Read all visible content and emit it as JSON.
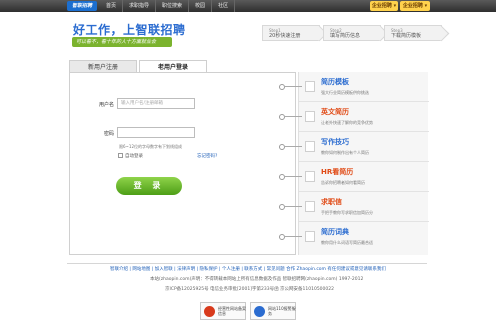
{
  "topbar": {
    "logo": "智联招聘",
    "nav": [
      "首页",
      "求职指导",
      "职位搜索",
      "校园",
      "社区"
    ],
    "enterprise_buttons": [
      "企业招聘 ▾",
      "企业招聘 ▾"
    ]
  },
  "header": {
    "slogan": "好工作，上智联招聘",
    "subslogan": "可以看不，看十年的人十方面就业会",
    "steps": [
      {
        "num": "Step1",
        "label": "20秒快速注册"
      },
      {
        "num": "Step2",
        "label": "填写简历信息"
      },
      {
        "num": "Step3",
        "label": "下载简历模板"
      }
    ]
  },
  "tabs": {
    "register": "新用户注册",
    "login": "老用户登录"
  },
  "form": {
    "username_label": "用户名",
    "username_placeholder": "输入用户名/注册邮箱",
    "password_label": "密码",
    "password_hint": "限6~12位的字母数字有下划线组成",
    "auto_login": "自动登录",
    "forgot": "忘记密码?",
    "login_button": "登 录"
  },
  "sidebar": {
    "items": [
      {
        "title": "简历模板",
        "desc": "强大行业简历模板供你挑选",
        "color": "#2b6cd0"
      },
      {
        "title": "英文简历",
        "desc": "让老外快速了解你的竞争优势",
        "color": "#e04a15"
      },
      {
        "title": "写作技巧",
        "desc": "教你如何制作出有个人简历",
        "color": "#2b6cd0"
      },
      {
        "title": "HR看简历",
        "desc": "告诉你招聘者如何看简历",
        "color": "#e04a15"
      },
      {
        "title": "求职信",
        "desc": "手把手教你写求职信加简历分",
        "color": "#e04a15"
      },
      {
        "title": "简历词典",
        "desc": "教你用什么词语写简历最合适",
        "color": "#2b6cd0"
      }
    ]
  },
  "footer": {
    "nav": "智联介绍 | 网站地图 | 加入智联 | 法律声明 | 隐私保护 | 个人注册 | 联系方式 | 常见问题 合作 Zhaopin.com 有任何建议或意见请联系我们",
    "line2": "本站(zhaopin.com)声明：不得转载本网站上所有信息数据及作品 智联招聘网(zhaopin.com) 1997-2012",
    "line3": "京ICP备12025925号 电信业务审批[2001]字第233号函 京公网安备11010500022",
    "badges": [
      {
        "text": "经营性网站备案信息",
        "color": "#d83a1c"
      },
      {
        "text": "网站110报警服务",
        "color": "#2b6cd0"
      }
    ]
  }
}
